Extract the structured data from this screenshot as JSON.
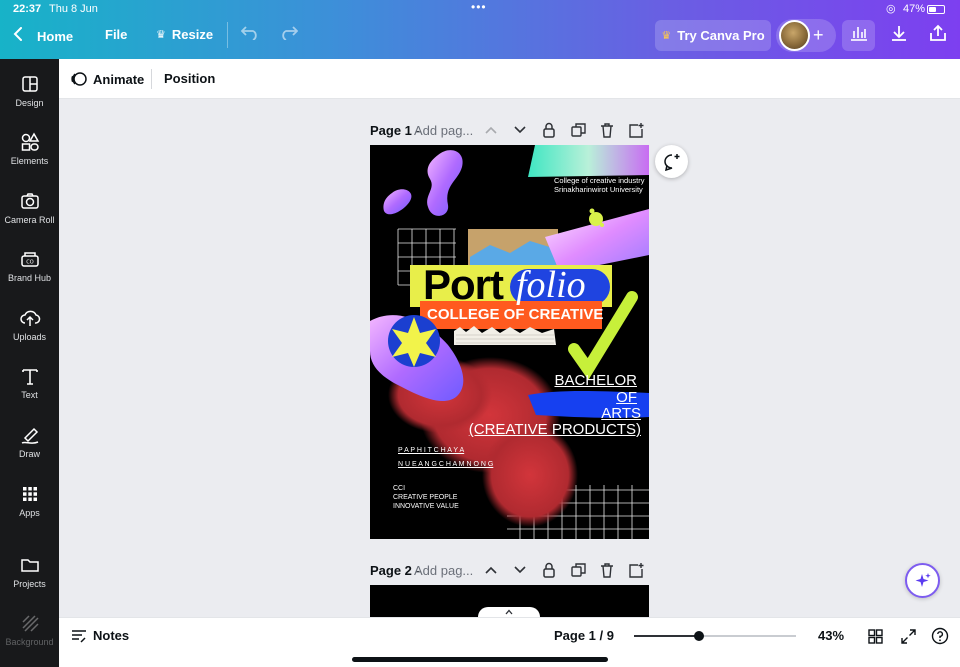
{
  "status": {
    "time": "22:37",
    "date": "Thu 8 Jun",
    "battery": "47%"
  },
  "topbar": {
    "home_label": "Home",
    "file_label": "File",
    "resize_label": "Resize",
    "try_pro_label": "Try Canva Pro",
    "accent": "#7d3ff0"
  },
  "sidebar": {
    "items": [
      {
        "label": "Design",
        "icon": "design-icon"
      },
      {
        "label": "Elements",
        "icon": "elements-icon"
      },
      {
        "label": "Camera Roll",
        "icon": "camera-icon"
      },
      {
        "label": "Brand Hub",
        "icon": "brand-hub-icon"
      },
      {
        "label": "Uploads",
        "icon": "upload-icon"
      },
      {
        "label": "Text",
        "icon": "text-icon"
      },
      {
        "label": "Draw",
        "icon": "draw-icon"
      },
      {
        "label": "Apps",
        "icon": "apps-icon"
      },
      {
        "label": "Projects",
        "icon": "folder-icon"
      },
      {
        "label": "Background",
        "icon": "background-icon"
      }
    ]
  },
  "context": {
    "animate_label": "Animate",
    "position_label": "Position"
  },
  "pages": [
    {
      "name": "Page 1 -",
      "title_placeholder": "Add pag..."
    },
    {
      "name": "Page 2 -",
      "title_placeholder": "Add pag..."
    }
  ],
  "poster": {
    "college_line1": "College of creative industry",
    "college_line2": "Srinakharinwirot University",
    "title_port": "Port",
    "title_folio": "folio",
    "banner": "COLLEGE OF CREATIVE",
    "bachelor": "BACHELOR",
    "of": "OF",
    "arts": "ARTS",
    "creative_products": "(CREATIVE PRODUCTS)",
    "name1": "P A P H I T C H A Y A",
    "name2": "N U E A N G C H A M N O N G",
    "cci1": "CCI",
    "cci2": "CREATIVE PEOPLE",
    "cci3": "INNOVATIVE VALUE"
  },
  "bottombar": {
    "notes_label": "Notes",
    "page_indicator": "Page 1 / 9",
    "zoom": "43%",
    "zoom_fraction": 0.4
  }
}
